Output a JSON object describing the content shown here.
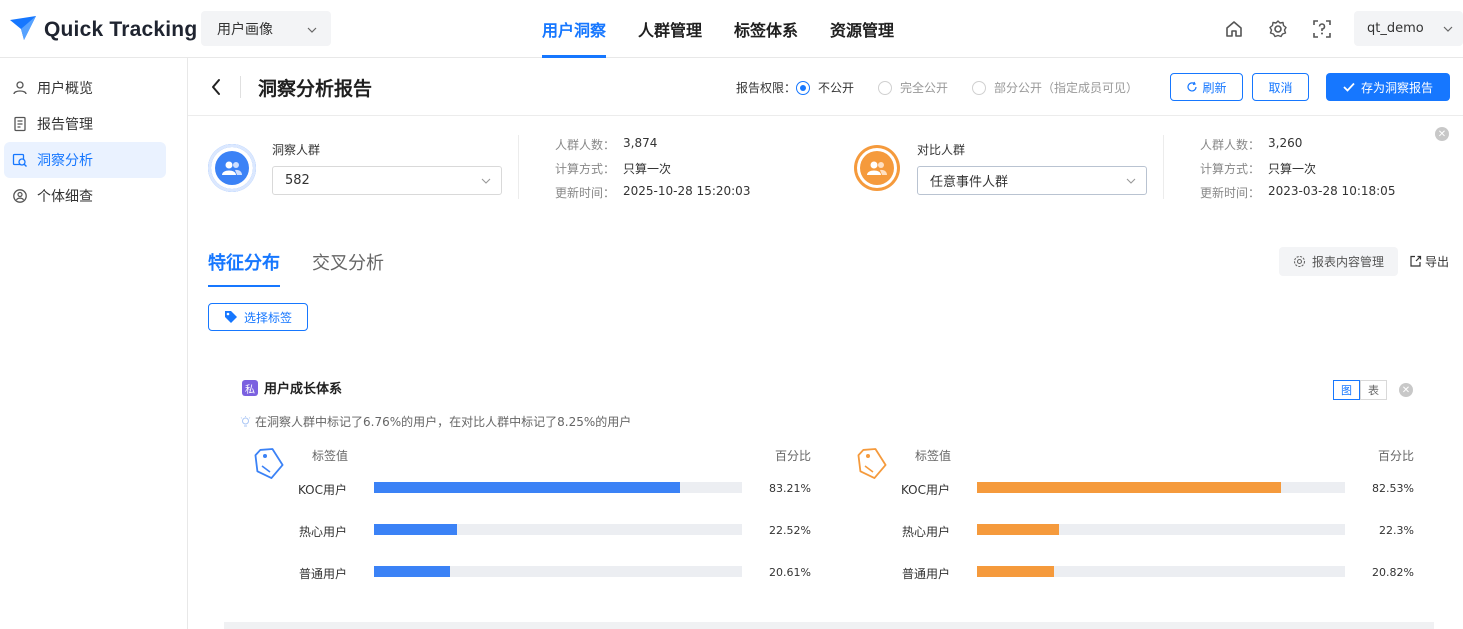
{
  "app": {
    "name": "Quick Tracking",
    "module": "用户画像",
    "user": "qt_demo"
  },
  "nav": [
    "用户洞察",
    "人群管理",
    "标签体系",
    "资源管理"
  ],
  "sidebar": [
    "用户概览",
    "报告管理",
    "洞察分析",
    "个体细查"
  ],
  "header": {
    "title": "洞察分析报告",
    "perm_label": "报告权限：",
    "perm_options": [
      "不公开",
      "完全公开",
      "部分公开（指定成员可见）"
    ],
    "selected_perm": "不公开",
    "refresh": "刷新",
    "cancel": "取消",
    "save": "存为洞察报告"
  },
  "insight_crowd": {
    "label": "洞察人群",
    "value": "582",
    "count_k": "人群人数：",
    "count_v": "3,874",
    "calc_k": "计算方式：",
    "calc_v": "只算一次",
    "update_k": "更新时间：",
    "update_v": "2025-10-28 15:20:03"
  },
  "compare_crowd": {
    "label": "对比人群",
    "value": "任意事件人群",
    "count_k": "人群人数：",
    "count_v": "3,260",
    "calc_k": "计算方式：",
    "calc_v": "只算一次",
    "update_k": "更新时间：",
    "update_v": "2023-03-28 10:18:05"
  },
  "tabs": [
    "特征分布",
    "交叉分析"
  ],
  "actions": {
    "manage": "报表内容管理",
    "export": "导出",
    "select_tag": "选择标签"
  },
  "card": {
    "badge": "私",
    "title": "用户成长体系",
    "view_chart": "图",
    "view_table": "表",
    "hint": "在洞察人群中标记了6.76%的用户，在对比人群中标记了8.25%的用户",
    "col_label": "标签值",
    "col_pct": "百分比"
  },
  "colors": {
    "primary": "#1677ff",
    "insight": "#3b82f6",
    "compare": "#f59a3c",
    "private_badge": "#7b61e0"
  },
  "chart_data": [
    {
      "type": "bar",
      "categories": [
        "KOC用户",
        "热心用户",
        "普通用户"
      ],
      "values": [
        83.21,
        22.52,
        20.61
      ],
      "value_labels": [
        "83.21%",
        "22.52%",
        "20.61%"
      ],
      "xlabel": "百分比",
      "ylabel": "标签值",
      "ylim": [
        0,
        100
      ]
    },
    {
      "type": "bar",
      "categories": [
        "KOC用户",
        "热心用户",
        "普通用户"
      ],
      "values": [
        82.53,
        22.3,
        20.82
      ],
      "value_labels": [
        "82.53%",
        "22.3%",
        "20.82%"
      ],
      "xlabel": "百分比",
      "ylabel": "标签值",
      "ylim": [
        0,
        100
      ]
    }
  ]
}
